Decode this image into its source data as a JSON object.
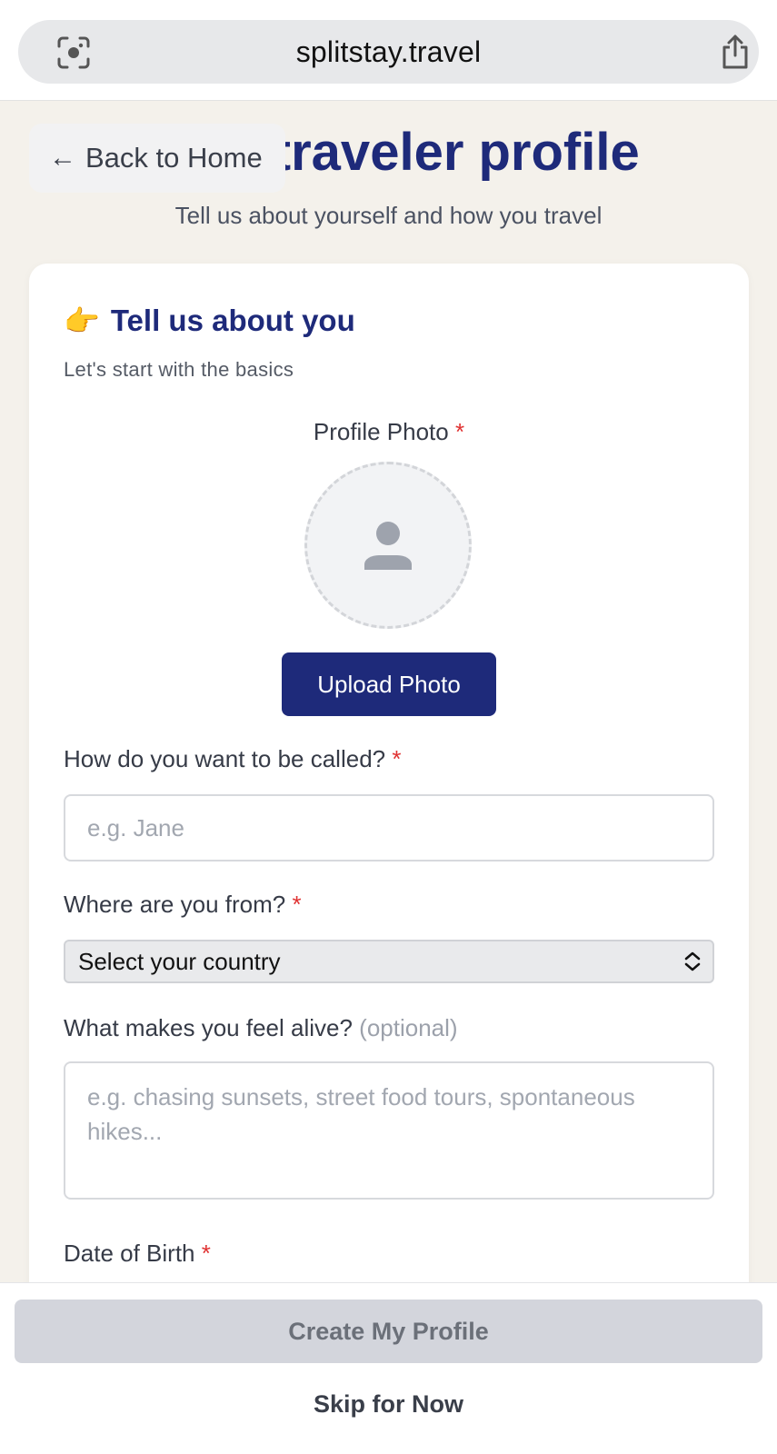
{
  "browser": {
    "url": "splitstay.travel"
  },
  "header": {
    "back_label": "Back to Home",
    "back_arrow": "←",
    "title": "our traveler profile",
    "subtitle": "Tell us about yourself and how you travel"
  },
  "section": {
    "emoji": "👉",
    "title": "Tell us about you",
    "subtitle": "Let's start with the basics"
  },
  "photo": {
    "label": "Profile Photo",
    "required": "*",
    "upload_label": "Upload Photo"
  },
  "name_field": {
    "label": "How do you want to be called?",
    "required": "*",
    "placeholder": "e.g. Jane",
    "value": ""
  },
  "country_field": {
    "label": "Where are you from?",
    "required": "*",
    "selected": "Select your country"
  },
  "alive_field": {
    "label": "What makes you feel alive?",
    "optional": "(optional)",
    "placeholder": "e.g. chasing sunsets, street food tours, spontaneous hikes...",
    "value": ""
  },
  "dob_field": {
    "label": "Date of Birth",
    "required": "*"
  },
  "actions": {
    "create_label": "Create My Profile",
    "skip_label": "Skip for Now"
  },
  "colors": {
    "brand": "#1e2a7a",
    "required": "#e03131",
    "page_bg": "#f4f1eb",
    "disabled_btn": "#d3d5dc"
  }
}
